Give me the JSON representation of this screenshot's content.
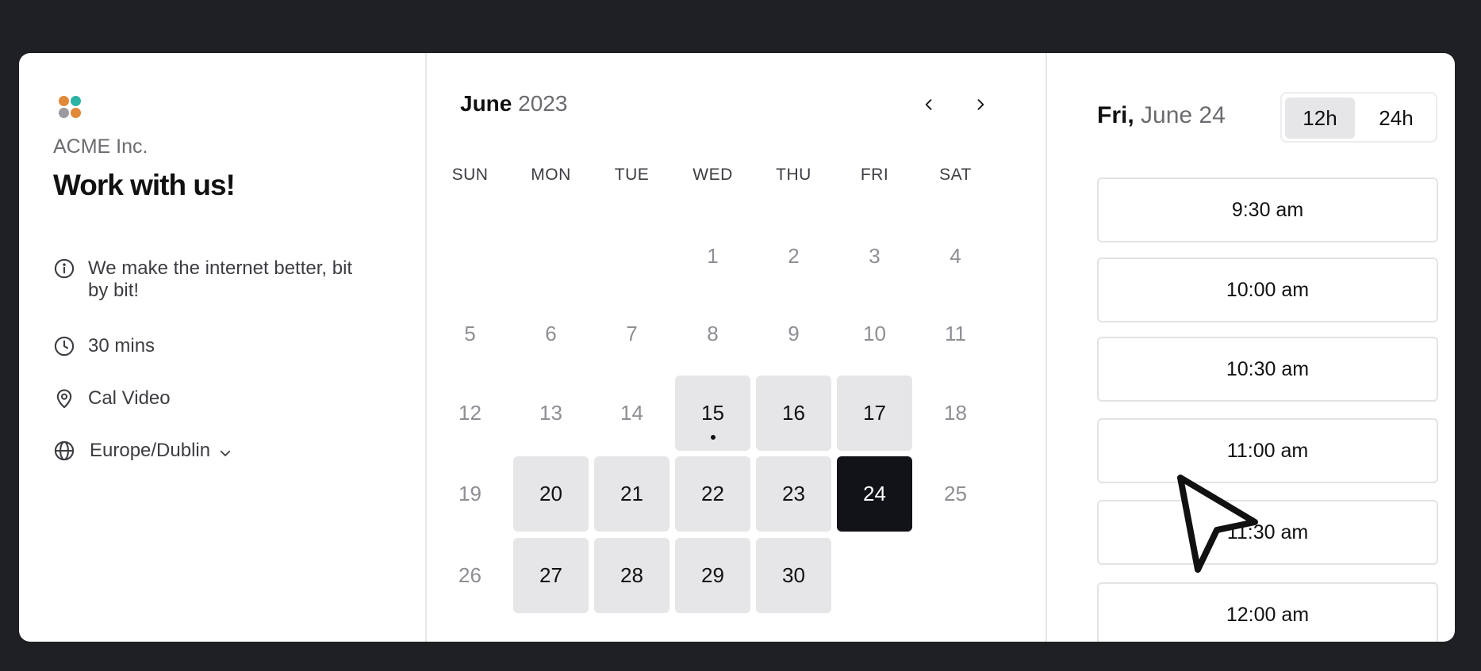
{
  "profile": {
    "company": "ACME Inc.",
    "event_title": "Work with us!",
    "description": "We make the internet better, bit by bit!",
    "duration": "30 mins",
    "location": "Cal Video",
    "timezone": "Europe/Dublin",
    "logo_colors": [
      "#e0893a",
      "#2bb3a6",
      "#9a9aa0",
      "#e0893a"
    ],
    "icons": {
      "description": "info-icon",
      "duration": "clock-icon",
      "location": "map-pin-icon",
      "timezone": "globe-icon",
      "timezone_dropdown": "chevron-down-icon"
    }
  },
  "calendar": {
    "month": "June",
    "year": "2023",
    "prev_icon": "chevron-left-icon",
    "next_icon": "chevron-right-icon",
    "weekdays": [
      "SUN",
      "MON",
      "TUE",
      "WED",
      "THU",
      "FRI",
      "SAT"
    ],
    "weeks": [
      [
        "",
        "",
        "",
        "1",
        "2",
        "3",
        "4"
      ],
      [
        "5",
        "6",
        "7",
        "8",
        "9",
        "10",
        "11"
      ],
      [
        "12",
        "13",
        "14",
        "15",
        "16",
        "17",
        "18"
      ],
      [
        "19",
        "20",
        "21",
        "22",
        "23",
        "24",
        "25"
      ],
      [
        "26",
        "27",
        "28",
        "29",
        "30",
        "",
        ""
      ]
    ],
    "available_days": [
      "15",
      "16",
      "17",
      "20",
      "21",
      "22",
      "23",
      "24",
      "27",
      "28",
      "29",
      "30"
    ],
    "selected_day": "24",
    "today": "15"
  },
  "schedule": {
    "weekday": "Fri,",
    "date": "June 24",
    "format_options": [
      "12h",
      "24h"
    ],
    "active_format": "12h",
    "slots": [
      "9:30 am",
      "10:00 am",
      "10:30 am",
      "11:00 am",
      "11:30 am",
      "12:00 am"
    ]
  }
}
